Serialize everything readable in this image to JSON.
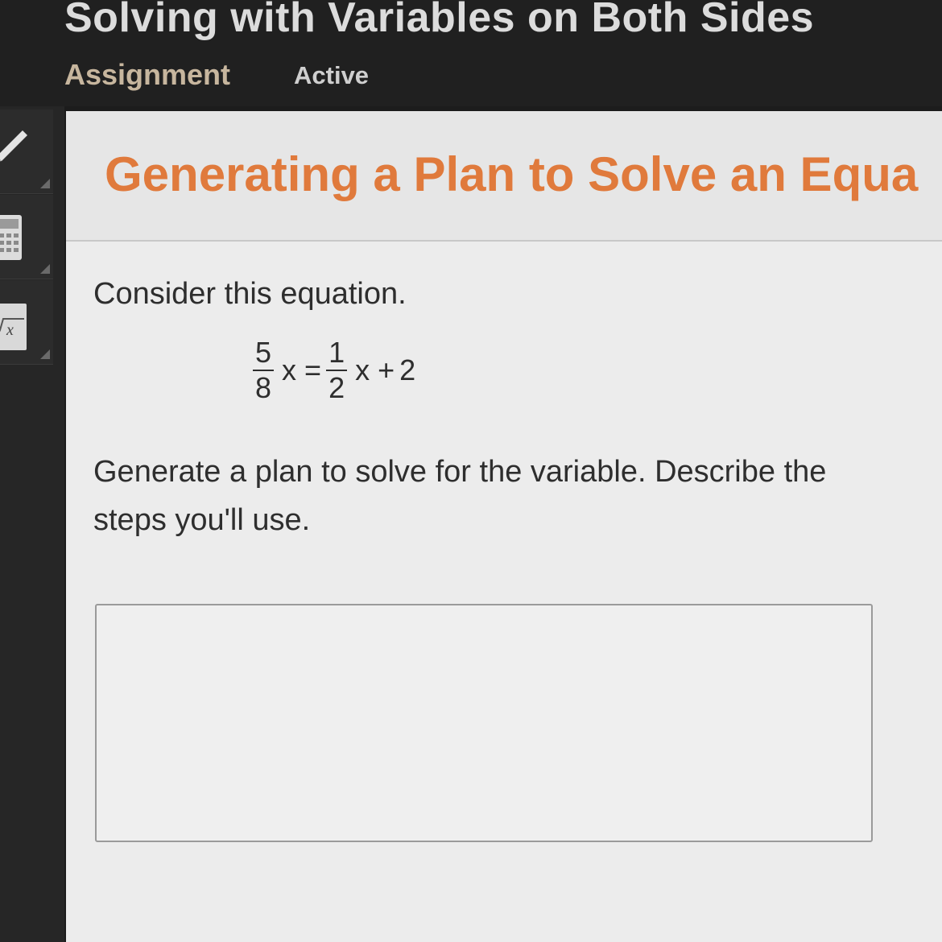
{
  "header": {
    "assignment_title": "Solving with Variables on Both Sides",
    "assignment_label": "Assignment",
    "status": "Active"
  },
  "tools": {
    "icons": [
      "pencil-icon",
      "calculator-icon",
      "formula-icon"
    ],
    "formula_glyph": "x"
  },
  "lesson": {
    "title": "Generating a Plan to Solve an Equa",
    "prompt_intro": "Consider this equation.",
    "equation": {
      "lhs_numerator": "5",
      "lhs_denominator": "8",
      "lhs_variable": "x",
      "equals": "=",
      "rhs_numerator": "1",
      "rhs_denominator": "2",
      "rhs_variable": "x",
      "plus": "+",
      "constant": "2"
    },
    "prompt_instruction": "Generate a plan to solve for the variable. Describe the steps you'll use.",
    "response_value": ""
  },
  "colors": {
    "title_orange": "#e07a3c",
    "assignment_tan": "#c7b69e",
    "header_bg": "#202020",
    "panel_bg": "#ececec"
  }
}
